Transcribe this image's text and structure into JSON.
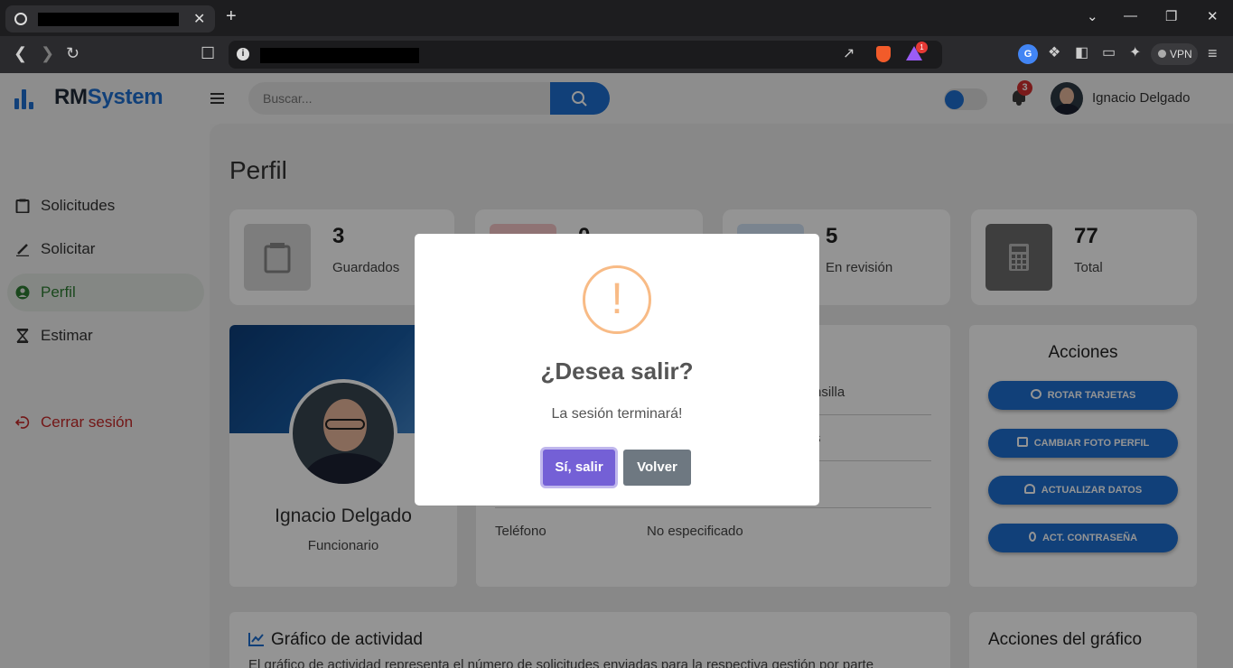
{
  "browser": {
    "tab_close": "✕",
    "new_tab": "+",
    "vpn_label": "VPN",
    "shield_badge": "1",
    "window_controls": [
      "⌄",
      "—",
      "❐",
      "✕"
    ]
  },
  "header": {
    "brand_dark": "RM",
    "brand_blue": "System",
    "search_placeholder": "Buscar...",
    "notification_count": "3",
    "user_name": "Ignacio Delgado"
  },
  "sidebar": {
    "items": [
      {
        "label": "Solicitudes",
        "icon": "clipboard-icon"
      },
      {
        "label": "Solicitar",
        "icon": "pencil-icon"
      },
      {
        "label": "Perfil",
        "icon": "user-circle-icon",
        "active": true
      },
      {
        "label": "Estimar",
        "icon": "hourglass-icon"
      }
    ],
    "logout_label": "Cerrar sesión"
  },
  "main": {
    "page_title": "Perfil",
    "stats": [
      {
        "value": "3",
        "label": "Guardados"
      },
      {
        "value": "0",
        "label": ""
      },
      {
        "value": "5",
        "label": "En revisión"
      },
      {
        "value": "77",
        "label": "Total"
      }
    ],
    "profile": {
      "name": "Ignacio Delgado",
      "role": "Funcionario"
    },
    "info": {
      "partial_values": [
        "nsilla",
        "s"
      ],
      "phone_label": "Teléfono",
      "phone_value": "No especificado"
    },
    "actions": {
      "title": "Acciones",
      "buttons": [
        "ROTAR TARJETAS",
        "CAMBIAR FOTO PERFIL",
        "ACTUALIZAR DATOS",
        "ACT. CONTRASEÑA"
      ]
    },
    "activity": {
      "title": "Gráfico de actividad",
      "description": "El gráfico de actividad representa el número de solicitudes enviadas para la respectiva gestión por parte"
    },
    "chart_actions_title": "Acciones del gráfico"
  },
  "modal": {
    "icon": "!",
    "title": "¿Desea salir?",
    "text": "La sesión terminará!",
    "confirm": "Sí, salir",
    "cancel": "Volver"
  },
  "colors": {
    "brand": "#1e6fd0",
    "confirm": "#7460d6",
    "cancel": "#6e7881",
    "warning": "#f8bb86",
    "logout": "#c62828",
    "active": "#2e7d32"
  }
}
